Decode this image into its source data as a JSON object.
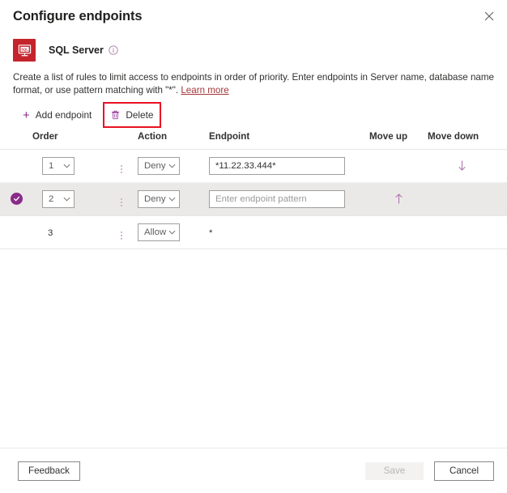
{
  "header": {
    "title": "Configure endpoints",
    "close_icon": "close-icon"
  },
  "resource": {
    "icon": "sql-server-icon",
    "icon_text": "SQL",
    "name": "SQL Server",
    "info_icon": "info-icon"
  },
  "description": {
    "text": "Create a list of rules to limit access to endpoints in order of priority. Enter endpoints in Server name, database name format, or use pattern matching with \"*\". ",
    "link_label": "Learn more"
  },
  "command_bar": {
    "add_label": "Add endpoint",
    "add_icon": "plus-icon",
    "delete_label": "Delete",
    "delete_icon": "trash-icon",
    "highlight_color": "#e81123"
  },
  "table": {
    "columns": [
      {
        "key": "check",
        "label": ""
      },
      {
        "key": "order",
        "label": "Order"
      },
      {
        "key": "dots",
        "label": ""
      },
      {
        "key": "action",
        "label": "Action"
      },
      {
        "key": "endpoint",
        "label": "Endpoint"
      },
      {
        "key": "move_up",
        "label": "Move up"
      },
      {
        "key": "move_down",
        "label": "Move down"
      },
      {
        "key": "info",
        "label": ""
      }
    ],
    "rows": [
      {
        "selected": false,
        "order": "1",
        "order_is_dropdown": true,
        "action": "Deny",
        "endpoint_value": "*11.22.33.444*",
        "endpoint_placeholder": "Enter endpoint pattern",
        "endpoint_is_input": true,
        "move_up": false,
        "move_down": true,
        "info": false
      },
      {
        "selected": true,
        "order": "2",
        "order_is_dropdown": true,
        "action": "Deny",
        "endpoint_value": "",
        "endpoint_placeholder": "Enter endpoint pattern",
        "endpoint_is_input": true,
        "move_up": true,
        "move_down": false,
        "info": false
      },
      {
        "selected": false,
        "order": "3",
        "order_is_dropdown": false,
        "action": "Allow",
        "endpoint_value": "*",
        "endpoint_placeholder": "",
        "endpoint_is_input": false,
        "move_up": false,
        "move_down": false,
        "info": true
      }
    ]
  },
  "footer": {
    "feedback_label": "Feedback",
    "save_label": "Save",
    "save_disabled": true,
    "cancel_label": "Cancel"
  },
  "colors": {
    "accent_purple": "#8a2b8a",
    "sql_red": "#c4242c",
    "link_red": "#a4373a",
    "row_selected_bg": "#ebe9e7"
  }
}
